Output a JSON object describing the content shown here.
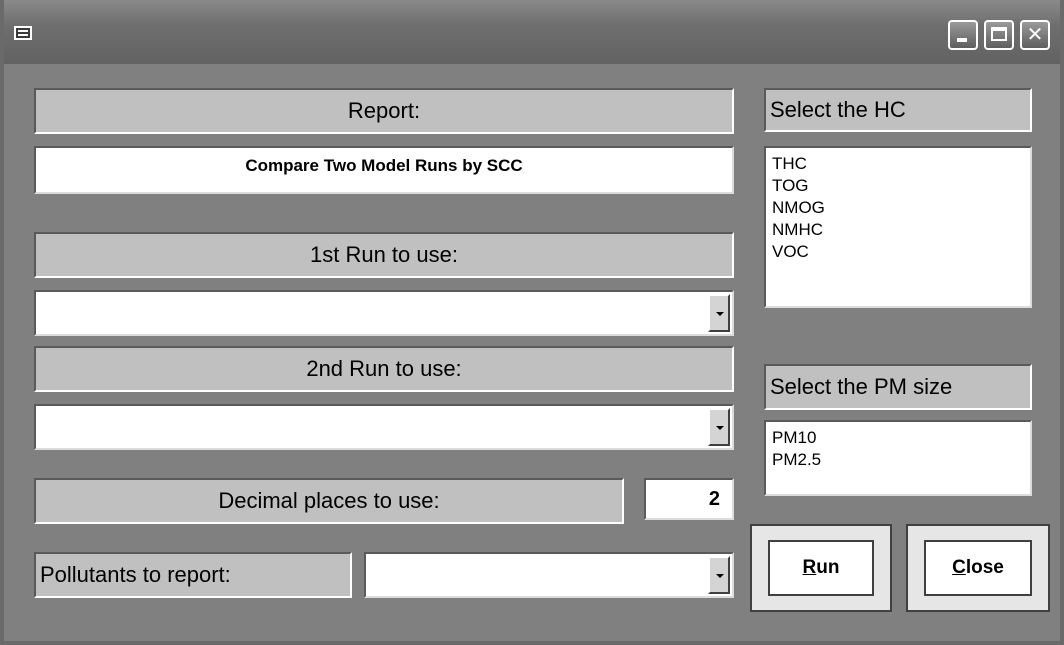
{
  "window": {
    "icon": "form-icon",
    "controls": {
      "minimize": "minimize-icon",
      "maximize": "maximize-icon",
      "close": "close-icon"
    }
  },
  "report": {
    "label": "Report:",
    "value": "Compare Two Model Runs by SCC"
  },
  "run1": {
    "label": "1st Run to use:",
    "value": ""
  },
  "run2": {
    "label": "2nd Run to use:",
    "value": ""
  },
  "decimals": {
    "label": "Decimal places to use:",
    "value": "2"
  },
  "pollutants": {
    "label": "Pollutants to report:",
    "value": ""
  },
  "hc": {
    "label": "Select the HC",
    "items": [
      "THC",
      "TOG",
      "NMOG",
      "NMHC",
      "VOC"
    ]
  },
  "pm": {
    "label": "Select the PM size",
    "items": [
      "PM10",
      "PM2.5"
    ]
  },
  "buttons": {
    "run_accel": "R",
    "run_rest": "un",
    "close_accel": "C",
    "close_rest": "lose"
  }
}
